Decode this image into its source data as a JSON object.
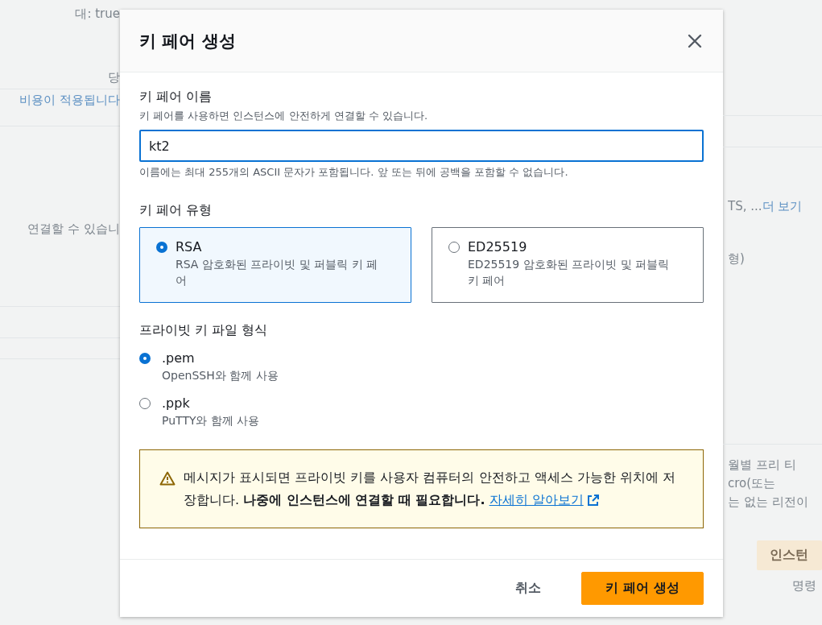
{
  "background": {
    "left": [
      {
        "kind": "text",
        "text": "대: true"
      },
      {
        "kind": "text",
        "text": "당"
      },
      {
        "kind": "link",
        "text": "비용이 적용됩니다"
      },
      {
        "kind": "text",
        "text": "연결할 수 있습니"
      }
    ],
    "right": [
      {
        "kind": "text",
        "text": "TS, ..."
      },
      {
        "kind": "link",
        "text": "더 보기"
      },
      {
        "kind": "text",
        "text": "형)"
      },
      {
        "kind": "text",
        "text": "월별 프리 티"
      },
      {
        "kind": "text",
        "text": "cro(또는"
      },
      {
        "kind": "text",
        "text": "는 없는 리전이"
      },
      {
        "kind": "button",
        "text": "인스턴"
      },
      {
        "kind": "text",
        "text": "명령"
      }
    ]
  },
  "modal": {
    "title": "키 페어 생성",
    "name": {
      "label": "키 페어 이름",
      "description": "키 페어를 사용하면 인스턴스에 안전하게 연결할 수 있습니다.",
      "value": "kt2",
      "hint": "이름에는 최대 255개의 ASCII 문자가 포함됩니다. 앞 또는 뒤에 공백을 포함할 수 없습니다."
    },
    "type": {
      "label": "키 페어 유형",
      "options": [
        {
          "label": "RSA",
          "description": "RSA 암호화된 프라이빗 및 퍼블릭 키 페어",
          "selected": true
        },
        {
          "label": "ED25519",
          "description": "ED25519 암호화된 프라이빗 및 퍼블릭 키 페어",
          "selected": false
        }
      ]
    },
    "format": {
      "label": "프라이빗 키 파일 형식",
      "options": [
        {
          "label": ".pem",
          "description": "OpenSSH와 함께 사용",
          "selected": true
        },
        {
          "label": ".ppk",
          "description": "PuTTY와 함께 사용",
          "selected": false
        }
      ]
    },
    "warning": {
      "text": "메시지가 표시되면 프라이빗 키를 사용자 컴퓨터의 안전하고 액세스 가능한 위치에 저장합니다. **나중에 인스턴스에 연결할 때 필요합니다.**",
      "link": "자세히 알아보기"
    },
    "buttons": [
      {
        "kind": "secondary",
        "label": "취소"
      },
      {
        "kind": "primary",
        "label": "키 페어 생성"
      }
    ]
  }
}
